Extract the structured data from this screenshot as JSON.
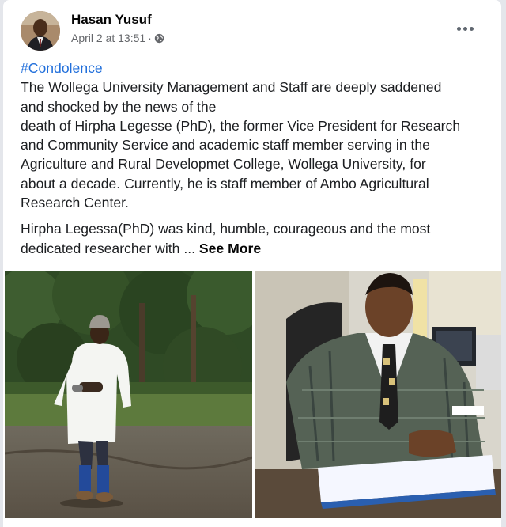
{
  "post": {
    "author": "Hasan Yusuf",
    "timestamp": "April 2 at 13:51",
    "separator": "·",
    "privacy_icon": "globe-icon",
    "more_icon": "more-horizontal-icon",
    "hashtag": "#Condolence",
    "line1": "The Wollega University Management and Staff are deeply saddened",
    "line2": "and shocked by the news of the",
    "line3": "death of Hirpha Legesse (PhD), the former Vice President for Research",
    "line4": "and Community Service and academic staff member serving in the",
    "line5": "Agriculture and Rural Developmet College, Wollega University, for",
    "line6": "about a decade. Currently, he is staff member of Ambo Agricultural",
    "line7": "Research Center.",
    "line8": "Hirpha Legessa(PhD) was kind, humble, courageous and the most",
    "line9": "dedicated researcher with ... ",
    "see_more": "See More"
  },
  "colors": {
    "hashtag": "#216fdb",
    "meta_text": "#65676b",
    "body_text": "#1c1e21",
    "page_bg": "#e4e6eb"
  }
}
